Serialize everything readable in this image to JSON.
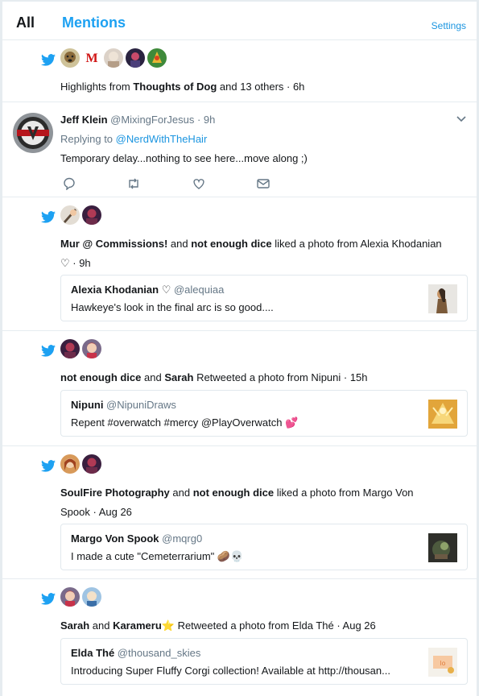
{
  "tabs": {
    "all": "All",
    "mentions": "Mentions",
    "settings": "Settings"
  },
  "notifications": [
    {
      "type": "highlights",
      "text_prefix": "Highlights from ",
      "name": "Thoughts of Dog",
      "text_suffix": " and 13 others · 6h"
    },
    {
      "type": "tweet",
      "author": "Jeff Klein",
      "handle": "@MixingForJesus · 9h",
      "replying_label": "Replying to ",
      "replying_handle": "@NerdWithTheHair",
      "text": "Temporary delay...nothing to see here...move along ;)"
    },
    {
      "type": "like",
      "name1": "Mur @ Commissions!",
      "joiner": " and ",
      "name2": "not enough dice",
      "action": " liked a photo from Alexia Khodanian",
      "line2": "♡ · 9h",
      "card_name": "Alexia Khodanian ♡",
      "card_handle": " @alequiaa",
      "card_text": "Hawkeye's look in the final arc is so good...."
    },
    {
      "type": "retweet",
      "name1": "not enough dice",
      "joiner": " and ",
      "name2": "Sarah",
      "action": " Retweeted a photo from Nipuni · 15h",
      "card_name": "Nipuni",
      "card_handle": " @NipuniDraws",
      "card_text": "Repent #overwatch #mercy @PlayOverwatch 💕"
    },
    {
      "type": "like",
      "name1": "SoulFire Photography",
      "joiner": " and ",
      "name2": "not enough dice",
      "action": " liked a photo from Margo Von",
      "line2": "Spook · Aug 26",
      "card_name": "Margo Von Spook",
      "card_handle": " @mqrg0",
      "card_text": "I made a cute \"Cemeterrarium\" 🥔💀"
    },
    {
      "type": "retweet",
      "name1": "Sarah",
      "joiner": " and ",
      "name2": "Karameru⭐",
      "action": " Retweeted a photo from Elda Thé · Aug 26",
      "card_name": "Elda Thé",
      "card_handle": " @thousand_skies",
      "card_text": "Introducing Super Fluffy Corgi collection! Available at http://thousan..."
    }
  ],
  "colors": {
    "accent": "#1da1f2",
    "link": "#1b95e0",
    "muted": "#657786",
    "border": "#e6ecf0"
  },
  "icons": [
    "twitter-bird-icon",
    "reply-icon",
    "retweet-icon",
    "like-icon",
    "direct-message-icon",
    "chevron-down-icon"
  ]
}
